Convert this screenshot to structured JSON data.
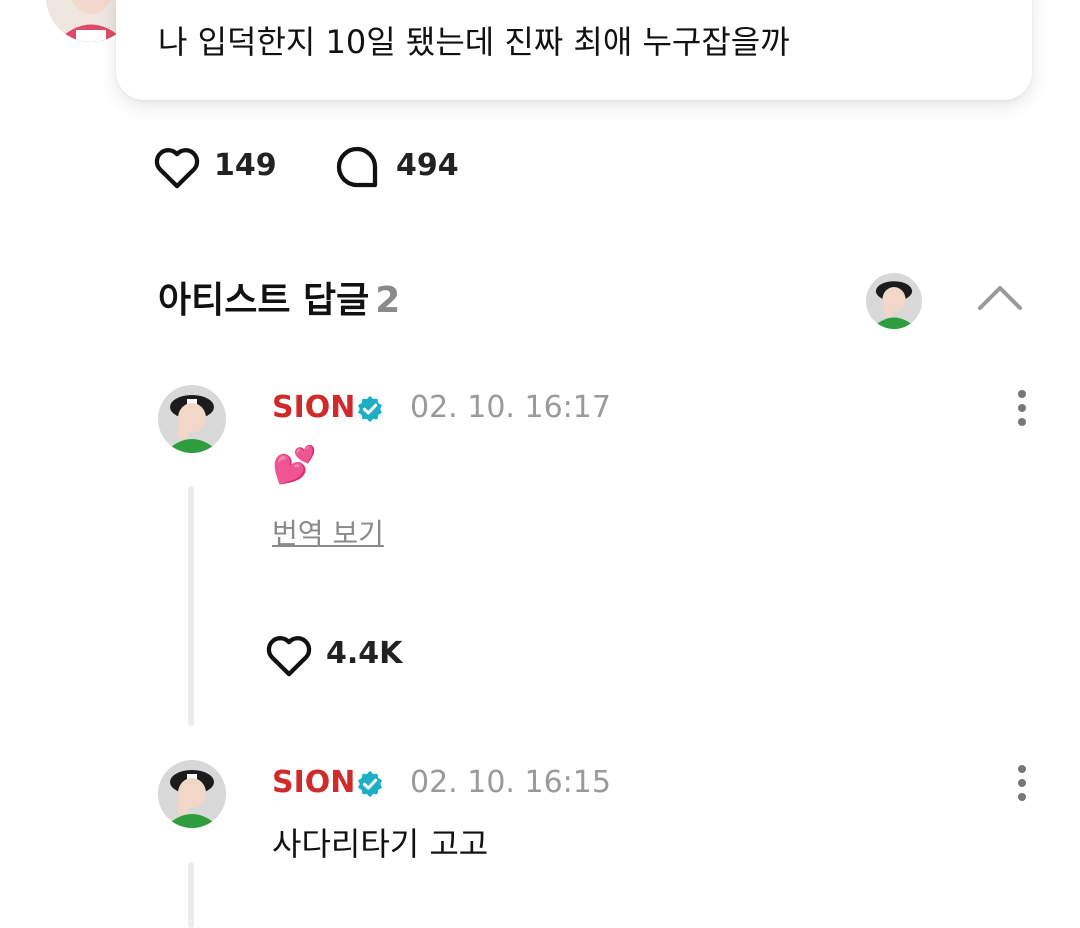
{
  "post": {
    "text": "나 입덕한지 10일 됐는데 진짜 최애 누구잡을까",
    "likes": "149",
    "comments": "494"
  },
  "artist_replies": {
    "title": "아티스트 답글",
    "count": "2"
  },
  "replies": [
    {
      "author": "SION",
      "timestamp": "02. 10. 16:17",
      "body": "💕",
      "translate_label": "번역 보기",
      "likes": "4.4K"
    },
    {
      "author": "SION",
      "timestamp": "02. 10. 16:15",
      "body": "사다리타기 고고"
    }
  ],
  "colors": {
    "author_name": "#d12a2a",
    "verified_badge": "#1db0c4",
    "timestamp": "#9a9a9a",
    "thread_line": "#ececec"
  },
  "icons": {
    "like": "heart-outline-icon",
    "comment": "speech-bubble-icon",
    "collapse": "chevron-up-icon",
    "more": "kebab-menu-icon",
    "verified": "verified-badge-icon"
  }
}
